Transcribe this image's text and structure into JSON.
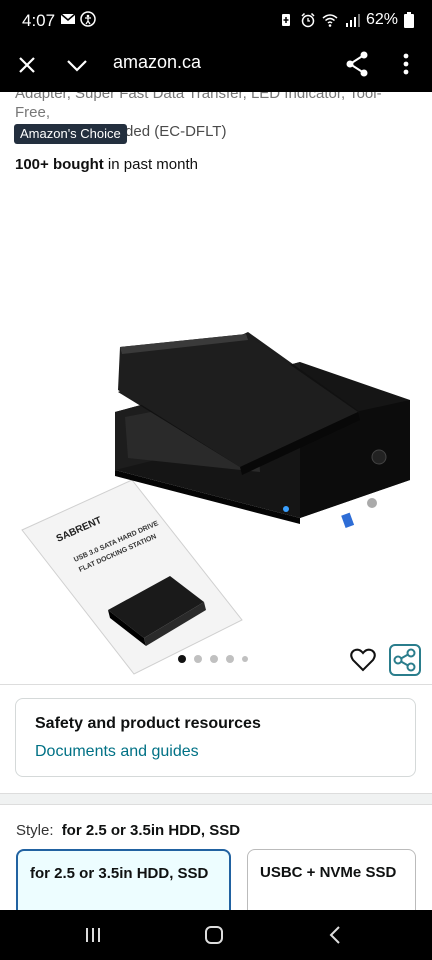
{
  "status_bar": {
    "time": "4:07",
    "battery": "62%",
    "icons": [
      "mail-icon",
      "accessibility-icon",
      "battery-saver-icon",
      "alarm-icon",
      "wifi-icon",
      "signal-icon",
      "battery-icon"
    ]
  },
  "browser": {
    "url": "amazon.ca",
    "icons": [
      "close-icon",
      "chevron-down-icon",
      "share-icon",
      "more-vert-icon"
    ]
  },
  "product": {
    "title_line1": "Adapter, Super Fast Data Transfer, LED Indicator, Tool-Free,",
    "title_line2": "USB Cable Included (EC-DFLT)",
    "badge": "Amazon's Choice",
    "bought_bold": "100+ bought",
    "bought_rest": " in past month",
    "image": {
      "brand": "SABRENT",
      "manual_line1": "USB 3.0 SATA HARD DRIVE",
      "manual_line2": "FLAT DOCKING STATION",
      "dot_count": 5,
      "active_dot": 1
    }
  },
  "safety": {
    "title": "Safety and product resources",
    "link": "Documents and guides"
  },
  "style": {
    "label": "Style:",
    "selected": "for 2.5 or 3.5in HDD, SSD",
    "options": [
      {
        "label": "for 2.5 or 3.5in HDD, SSD",
        "selected": true
      },
      {
        "label": "USBC + NVMe SSD",
        "selected": false
      }
    ]
  },
  "colors": {
    "link": "#007185",
    "badge_bg": "#232f3e",
    "selected_border": "#2162a1",
    "share_border": "#2a7d8c"
  }
}
